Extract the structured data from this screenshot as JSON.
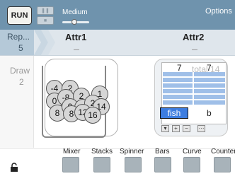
{
  "toolbar": {
    "run_label": "RUN",
    "speed_label": "Medium",
    "options_label": "Options",
    "speed_level": 0.45
  },
  "header": {
    "rep_label": "Rep...",
    "rep_value": "5",
    "attr1": "Attr1",
    "attr2": "Attr2"
  },
  "left": {
    "draw_label": "Draw",
    "draw_value": "2"
  },
  "mixer": {
    "balls": [
      "-4",
      "2",
      "0",
      "-8",
      "2",
      "1",
      "8",
      "0",
      "8",
      "2",
      "14",
      "8",
      "12",
      "16"
    ]
  },
  "device2": {
    "section_a_count": "7",
    "section_b_count": "7",
    "total_label": "total 14",
    "field_value": "fish",
    "section_b_label": "b",
    "buttons": [
      "▾",
      "+",
      "−",
      "···"
    ]
  },
  "palette": {
    "items": [
      "Mixer",
      "Stacks",
      "Spinner",
      "Bars",
      "Curve",
      "Counter"
    ]
  }
}
